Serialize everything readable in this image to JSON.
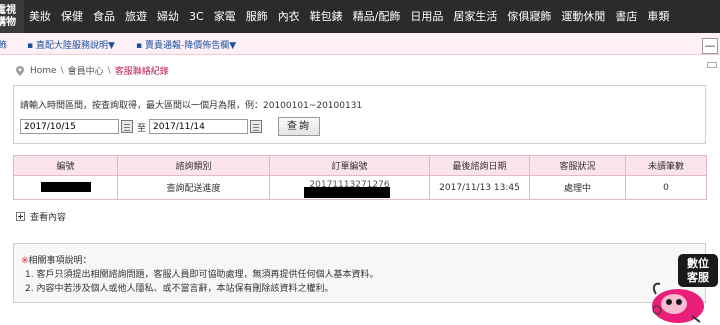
{
  "nav": {
    "brand_line1": "電視",
    "brand_line2": "購物",
    "items": [
      "美妝",
      "保健",
      "食品",
      "旅遊",
      "婦幼",
      "3C",
      "家電",
      "服飾",
      "內衣",
      "鞋包錶",
      "精品/配飾",
      "日用品",
      "居家生活",
      "傢俱寢飾",
      "運動休閒",
      "書店",
      "車類"
    ]
  },
  "subbar": {
    "left_fragment": "飾",
    "link1": "▪ 直配大陸服務說明▼",
    "link2": "▪ 賣貴通報-降價佈告欄▼"
  },
  "scroll_top_glyph": "—",
  "breadcrumb": {
    "home": "Home",
    "member": "會員中心",
    "current": "客服聯絡紀錄",
    "separator": "\\"
  },
  "query": {
    "hint": "請輸入時間區間，按查詢取得，最大區間以一個月為限，例：20100101~20100131",
    "start_date": "2017/10/15",
    "to_label": "至",
    "end_date": "2017/11/14",
    "button": "查詢"
  },
  "table": {
    "headers": [
      "編號",
      "諮詢類別",
      "訂單編號",
      "最後諮詢日期",
      "客服狀況",
      "未讀筆數"
    ],
    "rows": [
      {
        "category": "查詢配送進度",
        "order_partial": "20171113271276",
        "last_date": "2017/11/13 13:45",
        "status": "處理中",
        "unread": "0"
      }
    ]
  },
  "expand_label": "查看內容",
  "notes": {
    "mark": "※",
    "title": "相關事項說明：",
    "lines": [
      "1. 客戶只須提出相關諮詢問題，客服人員即可協助處理，無須再提供任何個人基本資料。",
      "2. 內容中若涉及個人或他人隱私、或不當言辭，本站保有刪除該資料之權利。"
    ]
  },
  "service": {
    "line1": "數位",
    "line2": "客服"
  },
  "colors": {
    "nav_bg": "#2b2b2b",
    "accent_pink": "#c2185b",
    "header_pink": "#fce4ec",
    "link_blue": "#1a52a0",
    "note_red": "#d32f2f"
  }
}
